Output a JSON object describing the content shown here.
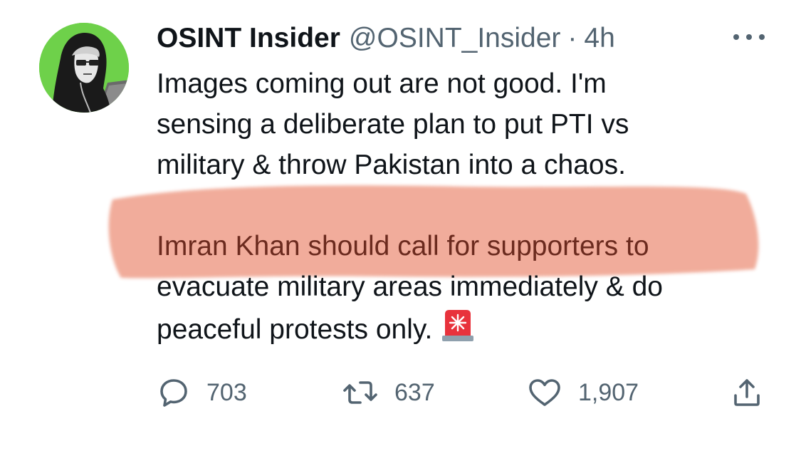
{
  "tweet": {
    "author": {
      "display_name": "OSINT Insider",
      "handle": "@OSINT_Insider",
      "avatar_icon": "hooded-figure-avatar",
      "avatar_bg": "#6ed14a"
    },
    "separator": "·",
    "time": "4h",
    "more_icon": "more-horizontal-icon",
    "body": {
      "lines_p1": [
        "Images coming out are not good. I'm",
        "sensing a deliberate plan to put PTI vs",
        "military & throw Pakistan into a chaos."
      ],
      "lines_p2": [
        "Imran Khan should call for supporters to",
        "evacuate military areas immediately & do",
        "peaceful protests only."
      ],
      "emoji": "🚨",
      "highlight_color": "#f0a693"
    },
    "actions": {
      "reply": {
        "icon": "reply-bubble-icon",
        "count": "703"
      },
      "retweet": {
        "icon": "retweet-icon",
        "count": "637"
      },
      "like": {
        "icon": "heart-icon",
        "count": "1,907"
      },
      "share": {
        "icon": "share-upload-icon"
      }
    }
  },
  "colors": {
    "text": "#0f1419",
    "muted": "#536471",
    "background": "#ffffff"
  }
}
